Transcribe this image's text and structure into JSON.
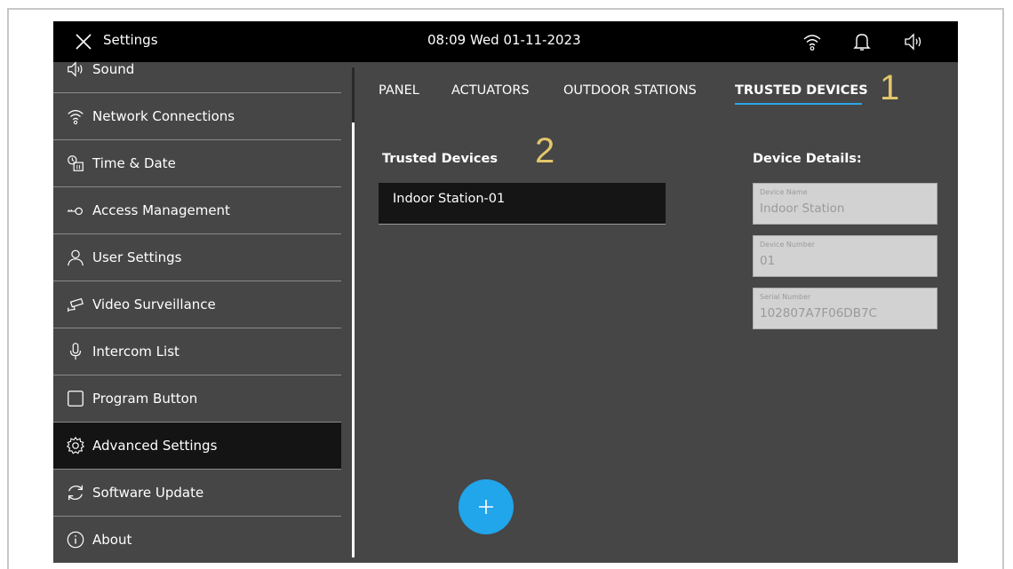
{
  "topbar": {
    "title": "Settings",
    "datetime": "08:09  Wed 01-11-2023",
    "icons": [
      "close-icon",
      "wifi-icon",
      "bell-icon",
      "speaker-icon"
    ]
  },
  "sidebar": {
    "items": [
      {
        "label": "Sound",
        "icon": "speaker-icon",
        "active": false
      },
      {
        "label": "Network Connections",
        "icon": "wifi-icon",
        "active": false
      },
      {
        "label": "Time & Date",
        "icon": "clock-calendar-icon",
        "active": false
      },
      {
        "label": "Access Management",
        "icon": "key-icon",
        "active": false
      },
      {
        "label": "User Settings",
        "icon": "user-icon",
        "active": false
      },
      {
        "label": "Video Surveillance",
        "icon": "camera-icon",
        "active": false
      },
      {
        "label": "Intercom List",
        "icon": "microphone-icon",
        "active": false
      },
      {
        "label": "Program Button",
        "icon": "square-button-icon",
        "active": false
      },
      {
        "label": "Advanced Settings",
        "icon": "gear-icon",
        "active": true
      },
      {
        "label": "Software Update",
        "icon": "refresh-icon",
        "active": false
      },
      {
        "label": "About",
        "icon": "info-icon",
        "active": false
      }
    ]
  },
  "tabs": [
    {
      "label": "PANEL",
      "active": false
    },
    {
      "label": "ACTUATORS",
      "active": false
    },
    {
      "label": "OUTDOOR STATIONS",
      "active": false
    },
    {
      "label": "TRUSTED DEVICES",
      "active": true
    }
  ],
  "callouts": {
    "one": "1",
    "two": "2"
  },
  "trusted_devices": {
    "title": "Trusted Devices",
    "items": [
      "Indoor Station-01"
    ]
  },
  "device_details": {
    "title": "Device Details:",
    "fields": [
      {
        "label": "Device Name",
        "value": "Indoor Station"
      },
      {
        "label": "Device Number",
        "value": "01"
      },
      {
        "label": "Serial Number",
        "value": "102807A7F06DB7C"
      }
    ]
  },
  "add_button": {
    "icon": "plus-icon"
  },
  "colors": {
    "accent": "#21a5eb",
    "callout": "#e3c66a",
    "topbar": "#000000",
    "panel": "#464646",
    "selected": "#141414"
  }
}
